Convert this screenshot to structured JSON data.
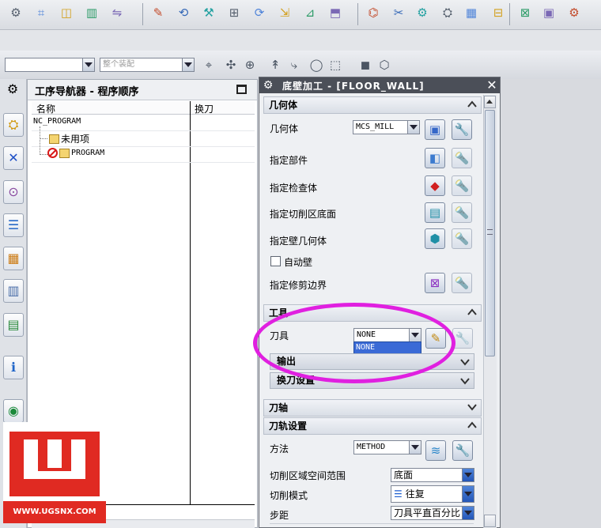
{
  "toolbar": {
    "assembly_filter": "",
    "assembly_scope": "整个装配",
    "icons_row1": [
      "operation-icon",
      "tool-icon",
      "geometry-icon",
      "method-icon",
      "program-icon",
      "create-icon-a",
      "create-icon-b",
      "create-icon-c",
      "create-icon-d",
      "create-icon-e",
      "create-icon-f",
      "create-icon-g",
      "create-icon-h",
      "verify-icon",
      "path-icon",
      "simulate-icon",
      "post-icon",
      "output-icon",
      "shop-doc-icon",
      "machine-icon",
      "report-icon",
      "gear-dropdown-icon"
    ]
  },
  "navigator": {
    "title": "工序导航器 - 程序顺序",
    "columns": [
      "名称",
      "换刀"
    ],
    "rows": [
      {
        "name": "NC_PROGRAM",
        "level": 0
      },
      {
        "name": "未用项",
        "level": 1
      },
      {
        "name": "PROGRAM",
        "level": 1
      }
    ]
  },
  "dialog": {
    "title": "底壁加工 - [FLOOR_WALL]",
    "sections": {
      "geometry": {
        "header": "几何体",
        "geometry_label": "几何体",
        "geometry_value": "MCS_MILL",
        "specify_part": "指定部件",
        "specify_check": "指定检查体",
        "specify_floor": "指定切削区底面",
        "specify_wall": "指定壁几何体",
        "auto_wall": "自动壁",
        "specify_trim": "指定修剪边界"
      },
      "tool": {
        "header": "工具",
        "tool_label": "刀具",
        "tool_value": "NONE",
        "tool_option": "NONE",
        "output": "输出",
        "tool_change": "换刀设置"
      },
      "axis": {
        "header": "刀轴"
      },
      "path": {
        "header": "刀轨设置",
        "method_label": "方法",
        "method_value": "METHOD",
        "cut_region_label": "切削区域空间范围",
        "cut_region_value": "底面",
        "cut_mode_label": "切削模式",
        "cut_mode_value": "往复",
        "stepover_label": "步距",
        "stepover_value": "刀具平直百分比"
      }
    }
  },
  "watermark": {
    "url": "WWW.UGSNX.COM"
  },
  "colors": {
    "annotation": "#e020e0",
    "dialog_title": "#4b4f58",
    "logo_red": "#e02a22"
  }
}
